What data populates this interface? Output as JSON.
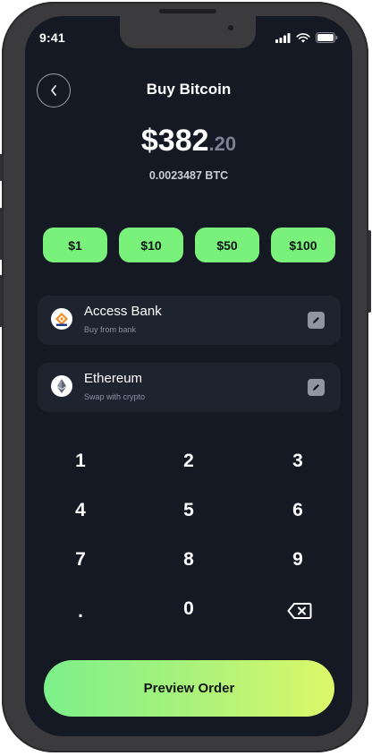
{
  "status_bar": {
    "time": "9:41"
  },
  "header": {
    "title": "Buy Bitcoin"
  },
  "amount": {
    "main": "$382",
    "cents": ".20",
    "btc": "0.0023487 BTC"
  },
  "presets": [
    "$1",
    "$10",
    "$50",
    "$100"
  ],
  "sources": [
    {
      "name": "Access Bank",
      "subtitle": "Buy from bank",
      "icon": "access-bank-logo-icon"
    },
    {
      "name": "Ethereum",
      "subtitle": "Swap with crypto",
      "icon": "ethereum-logo-icon"
    }
  ],
  "keypad": {
    "k1": "1",
    "k2": "2",
    "k3": "3",
    "k4": "4",
    "k5": "5",
    "k6": "6",
    "k7": "7",
    "k8": "8",
    "k9": "9",
    "dot": ".",
    "k0": "0",
    "backspace_icon": "backspace-icon"
  },
  "cta": {
    "label": "Preview Order"
  },
  "colors": {
    "background": "#141924",
    "accent": "#79f17a",
    "card": "#1e2330"
  }
}
